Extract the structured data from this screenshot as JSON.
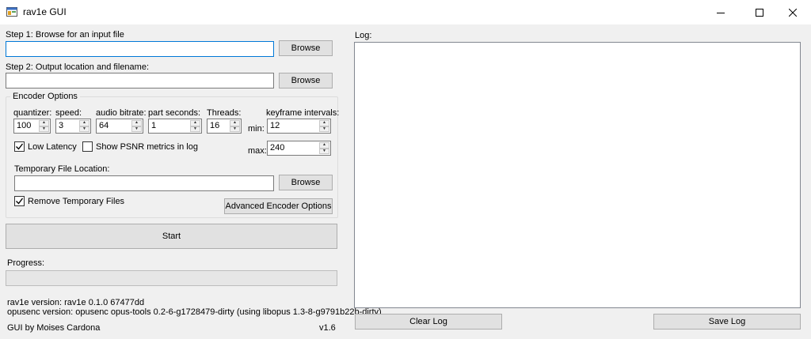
{
  "window": {
    "title": "rav1e GUI",
    "minimize_glyph": "—",
    "maximize_glyph": "☐",
    "close_glyph": "✕"
  },
  "step1": {
    "label": "Step 1: Browse for an input file",
    "value": "",
    "browse_label": "Browse"
  },
  "step2": {
    "label": "Step 2: Output location and filename:",
    "value": "",
    "browse_label": "Browse"
  },
  "encoder": {
    "group_title": "Encoder Options",
    "quantizer": {
      "label": "quantizer:",
      "value": "100"
    },
    "speed": {
      "label": "speed:",
      "value": "3"
    },
    "audio_bitrate": {
      "label": "audio bitrate:",
      "value": "64"
    },
    "part_seconds": {
      "label": "part seconds:",
      "value": "1"
    },
    "threads": {
      "label": "Threads:",
      "value": "16"
    },
    "keyframe": {
      "label": "keyframe intervals:",
      "min_label": "min:",
      "min_value": "12",
      "max_label": "max:",
      "max_value": "240"
    },
    "low_latency": {
      "label": "Low Latency",
      "checked": true
    },
    "show_psnr": {
      "label": "Show PSNR metrics in log",
      "checked": false
    },
    "temp_location": {
      "label": "Temporary File Location:",
      "value": "",
      "browse_label": "Browse"
    },
    "remove_temp": {
      "label": "Remove Temporary Files",
      "checked": true
    },
    "advanced_label": "Advanced Encoder Options"
  },
  "start_label": "Start",
  "progress": {
    "label": "Progress:",
    "value": 0
  },
  "versions": {
    "rav1e": "rav1e version: rav1e 0.1.0 67477dd",
    "opusenc": "opusenc version: opusenc opus-tools 0.2-6-g1728479-dirty (using libopus 1.3-8-g9791b22b-dirty)"
  },
  "footer": {
    "author": "GUI by Moises Cardona",
    "version": "v1.6"
  },
  "log": {
    "label": "Log:",
    "content": "",
    "clear_label": "Clear Log",
    "save_label": "Save Log"
  },
  "colors": {
    "focus_border": "#0078d7",
    "button_face": "#e1e1e1",
    "window_bg": "#f0f0f0"
  }
}
